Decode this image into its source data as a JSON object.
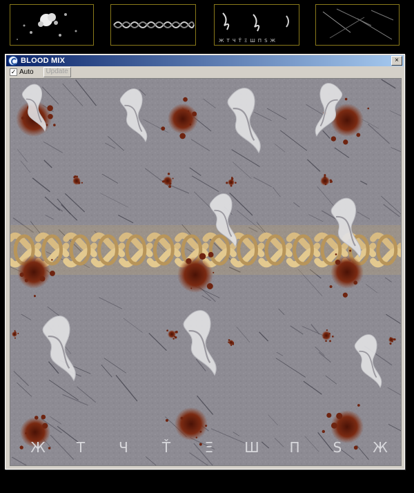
{
  "thumbnails": [
    {
      "name": "blood-splatter"
    },
    {
      "name": "celtic-knot-band"
    },
    {
      "name": "tribal-glyphs"
    },
    {
      "name": "scratches"
    }
  ],
  "window": {
    "title": "BLOOD MIX",
    "close_glyph": "×"
  },
  "toolbar": {
    "auto_checked": true,
    "auto_check_glyph": "✓",
    "auto_label": "Auto",
    "update_label": "Update"
  },
  "texture": {
    "base_color": "#8d8b93",
    "knot_color": "#d8bb82",
    "blood_color": "#6e2410",
    "tribal_color": "#e2e2e4",
    "rune_row": [
      "Ж",
      "Т",
      "Ч",
      "Ť",
      "Ξ",
      "Ш",
      "Π",
      "Ѕ",
      "Ж"
    ]
  }
}
